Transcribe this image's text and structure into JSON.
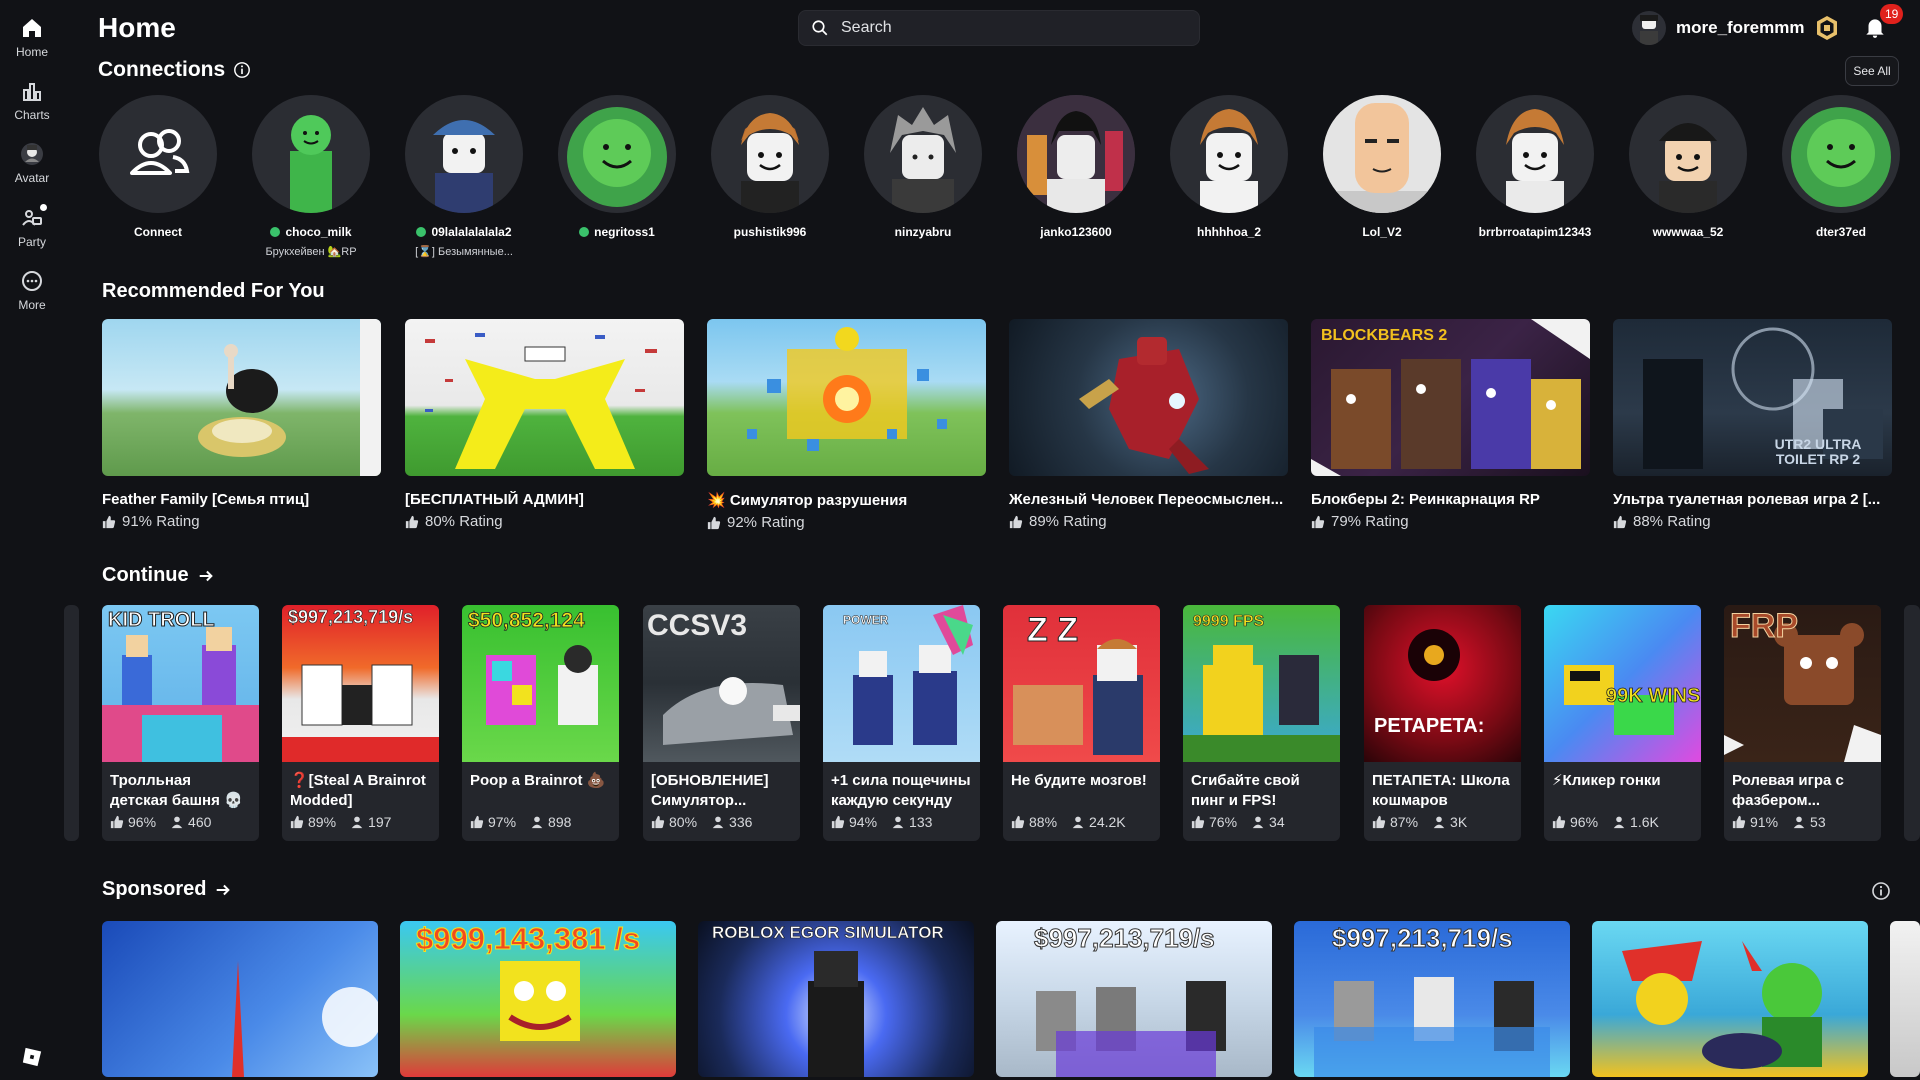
{
  "sidebar": {
    "items": [
      {
        "label": "Home",
        "icon": "home-icon"
      },
      {
        "label": "Charts",
        "icon": "charts-icon"
      },
      {
        "label": "Avatar",
        "icon": "avatar-icon"
      },
      {
        "label": "Party",
        "icon": "party-icon"
      },
      {
        "label": "More",
        "icon": "more-icon"
      }
    ]
  },
  "header": {
    "title": "Home",
    "search_placeholder": "Search",
    "username": "more_foremmm",
    "notification_count": "19"
  },
  "connections": {
    "title": "Connections",
    "see_all": "See All",
    "friends": [
      {
        "name": "Connect",
        "online": false,
        "game": ""
      },
      {
        "name": "choco_milk",
        "online": true,
        "game": "Брукхейвен 🏡RP"
      },
      {
        "name": "09lalalalalala2",
        "online": true,
        "game": "[⌛] Безымянные..."
      },
      {
        "name": "negritoss1",
        "online": true,
        "game": ""
      },
      {
        "name": "pushistik996",
        "online": false,
        "game": ""
      },
      {
        "name": "ninzyabru",
        "online": false,
        "game": ""
      },
      {
        "name": "janko123600",
        "online": false,
        "game": ""
      },
      {
        "name": "hhhhhoa_2",
        "online": false,
        "game": ""
      },
      {
        "name": "Lol_V2",
        "online": false,
        "game": ""
      },
      {
        "name": "brrbrroatapim12343",
        "online": false,
        "game": ""
      },
      {
        "name": "wwwwaa_52",
        "online": false,
        "game": ""
      },
      {
        "name": "dter37ed",
        "online": false,
        "game": ""
      }
    ]
  },
  "recommended": {
    "title": "Recommended For You",
    "games": [
      {
        "title": "Feather Family [Семья птиц]",
        "rating": "91% Rating",
        "thumb_text": ""
      },
      {
        "title": "[БЕСПЛАТНЫЙ АДМИН]",
        "rating": "80% Rating",
        "thumb_text": ""
      },
      {
        "title": "💥 Симулятор разрушения",
        "rating": "92% Rating",
        "thumb_text": ""
      },
      {
        "title": "Железный Человек Переосмыслен...",
        "rating": "89% Rating",
        "thumb_text": ""
      },
      {
        "title": "Блокберы 2: Реинкарнация RP",
        "rating": "79% Rating",
        "thumb_text": "BLOCKBEARS 2"
      },
      {
        "title": "Ультра туалетная ролевая игра 2 [...",
        "rating": "88% Rating",
        "thumb_text": "UTR2 ULTRA TOILET RP 2"
      }
    ]
  },
  "continue": {
    "title": "Continue",
    "games": [
      {
        "title": "Тролльная детская башня 💀",
        "rating": "96%",
        "players": "460",
        "thumb_text": "KID TROLL"
      },
      {
        "title": "❓[Steal A Brainrot Modded]",
        "rating": "89%",
        "players": "197",
        "thumb_text": "$997,213,719/s"
      },
      {
        "title": "Poop a Brainrot 💩",
        "rating": "97%",
        "players": "898",
        "thumb_text": "$50,852,124"
      },
      {
        "title": "[ОБНОВЛЕНИЕ] Симулятор...",
        "rating": "80%",
        "players": "336",
        "thumb_text": "CCSV3"
      },
      {
        "title": "+1 сила пощечины каждую секунду",
        "rating": "94%",
        "players": "133",
        "thumb_text": "POWER"
      },
      {
        "title": "Не будите мозгов!",
        "rating": "88%",
        "players": "24.2K",
        "thumb_text": "Z Z"
      },
      {
        "title": "Сгибайте свой пинг и FPS!",
        "rating": "76%",
        "players": "34",
        "thumb_text": "9999 FPS"
      },
      {
        "title": "ПЕТАПЕТА: Школа кошмаров",
        "rating": "87%",
        "players": "3K",
        "thumb_text": "PETAPETA:"
      },
      {
        "title": "⚡Кликер гонки",
        "rating": "96%",
        "players": "1.6K",
        "thumb_text": "99K WINS"
      },
      {
        "title": "Ролевая игра с фазбером...",
        "rating": "91%",
        "players": "53",
        "thumb_text": "FRP"
      }
    ]
  },
  "sponsored": {
    "title": "Sponsored",
    "games": [
      {
        "thumb_text": ""
      },
      {
        "thumb_text": "$999,143,381 /s"
      },
      {
        "thumb_text": "ROBLOX EGOR SIMULATOR"
      },
      {
        "thumb_text": "$997,213,719/s"
      },
      {
        "thumb_text": "$997,213,719/s"
      },
      {
        "thumb_text": ""
      }
    ]
  },
  "colors": {
    "background": "#111216",
    "card": "#24262c",
    "online": "#3ac26b",
    "badge": "#e0211c"
  }
}
